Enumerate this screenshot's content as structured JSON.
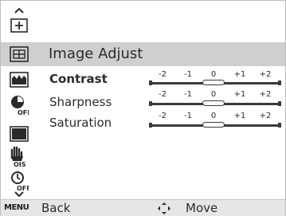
{
  "menu": {
    "title": "Image Adjust",
    "items": [
      {
        "label": "Contrast",
        "selected": true,
        "value": 0
      },
      {
        "label": "Sharpness",
        "selected": false,
        "value": 0
      },
      {
        "label": "Saturation",
        "selected": false,
        "value": 0
      }
    ],
    "scale_ticks": [
      "-2",
      "-1",
      "0",
      "+1",
      "+2"
    ]
  },
  "sidebar": {
    "icons": [
      "scroll-up-arrow-icon",
      "plus-box-icon",
      "image-adjust-icon",
      "landscape-scene-icon",
      "face-detect-off-icon",
      "black-frame-icon",
      "hand-ois-icon",
      "timer-off-icon",
      "scroll-down-arrow-icon"
    ],
    "text": {
      "ois": "OIS",
      "off1": "OFF",
      "off2": "OFF"
    }
  },
  "footer": {
    "menu_key": "MENU",
    "back_label": "Back",
    "move_label": "Move"
  },
  "colors": {
    "highlight": "#cfcfcf",
    "footer_bg": "#e6e6e6",
    "text": "#2b2b2b"
  }
}
